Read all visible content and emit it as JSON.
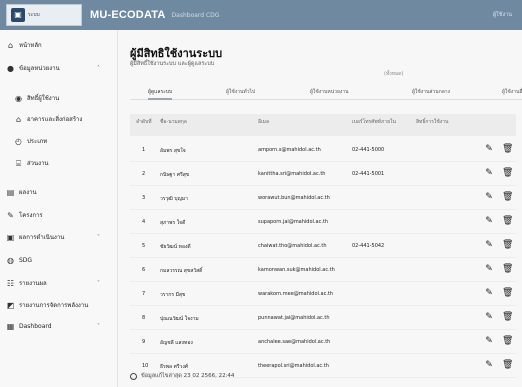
{
  "topbar": {
    "logo_text": "ระบบ",
    "brand": "MU-ECODATA",
    "subtitle": "Dashboard CDG",
    "right_text": "ผู้ใช้งาน"
  },
  "sidebar": {
    "items": [
      {
        "label": "หน้าหลัก",
        "icon": "home-icon"
      },
      {
        "label": "ข้อมูลหน่วยงาน",
        "icon": "info-icon"
      },
      {
        "label": "สิทธิ์ผู้ใช้งาน",
        "icon": "user-icon"
      },
      {
        "label": "อาคารและสิ่งก่อสร้าง",
        "icon": "building-icon"
      },
      {
        "label": "ประเภท",
        "icon": "clock-icon"
      },
      {
        "label": "ส่วนงาน",
        "icon": "institution-icon"
      },
      {
        "label": "ผลงาน",
        "icon": "chart-icon"
      },
      {
        "label": "โครงการ",
        "icon": "wrench-icon"
      },
      {
        "label": "ผลการดำเนินงาน",
        "icon": "report-icon"
      },
      {
        "label": "SDG",
        "icon": "sdg-icon"
      },
      {
        "label": "รายงานผล",
        "icon": "list-icon"
      },
      {
        "label": "รายงานการจัดการพลังงาน",
        "icon": "chart-bar-icon"
      },
      {
        "label": "Dashboard",
        "icon": "dashboard-icon"
      }
    ]
  },
  "main": {
    "title": "ผู้มีสิทธิใช้งานระบบ",
    "subtitle": "ผู้มีสิทธิ์ใช้งานระบบ และผู้ดูแลระบบ",
    "badge": "(ทั้งหมด)",
    "tabs": [
      "ผู้ดูแลระบบ",
      "ผู้ใช้งานทั่วไป",
      "ผู้ใช้งานหน่วยงาน",
      "ผู้ใช้งานส่วนกลาง",
      "ผู้ใช้งานอื่นๆ"
    ]
  },
  "table": {
    "headers": [
      "ลำดับที่",
      "ชื่อ-นามสกุล",
      "อีเมล",
      "เบอร์โทรศัพท์ภายใน",
      "สิทธิ์การใช้งาน"
    ],
    "rows": [
      {
        "no": "1",
        "name": "อัมพร สุขใจ",
        "email": "amporn.s@mahidol.ac.th",
        "phone": "02-441-5000",
        "role": ""
      },
      {
        "no": "2",
        "name": "กนิษฐา ศรีสุข",
        "email": "kanittha.sri@mahidol.ac.th",
        "phone": "02-441-5001",
        "role": ""
      },
      {
        "no": "3",
        "name": "วรวุฒิ บุญมา",
        "email": "worawut.bun@mahidol.ac.th",
        "phone": "",
        "role": ""
      },
      {
        "no": "4",
        "name": "สุภาพร ใจดี",
        "email": "supaporn.jai@mahidol.ac.th",
        "phone": "",
        "role": ""
      },
      {
        "no": "5",
        "name": "ชัยวัฒน์ ทองดี",
        "email": "chaiwat.tho@mahidol.ac.th",
        "phone": "02-441-5042",
        "role": ""
      },
      {
        "no": "6",
        "name": "กมลวรรณ สุขสวัสดิ์",
        "email": "kamonwan.suk@mahidol.ac.th",
        "phone": "",
        "role": ""
      },
      {
        "no": "7",
        "name": "วรากร มีสุข",
        "email": "warakorn.mee@mahidol.ac.th",
        "phone": "",
        "role": ""
      },
      {
        "no": "8",
        "name": "ปุณณวัฒน์ ใจงาม",
        "email": "punnawat.jai@mahidol.ac.th",
        "phone": "",
        "role": ""
      },
      {
        "no": "9",
        "name": "อัญชลี แสงทอง",
        "email": "anchalee.sae@mahidol.ac.th",
        "phone": "",
        "role": ""
      },
      {
        "no": "10",
        "name": "ธีรพล ศรีวงศ์",
        "email": "theerapol.sri@mahidol.ac.th",
        "phone": "",
        "role": ""
      }
    ]
  },
  "footer": {
    "note": "ข้อมูลแก้ไขล่าสุด 23 02 2566, 22:44"
  }
}
